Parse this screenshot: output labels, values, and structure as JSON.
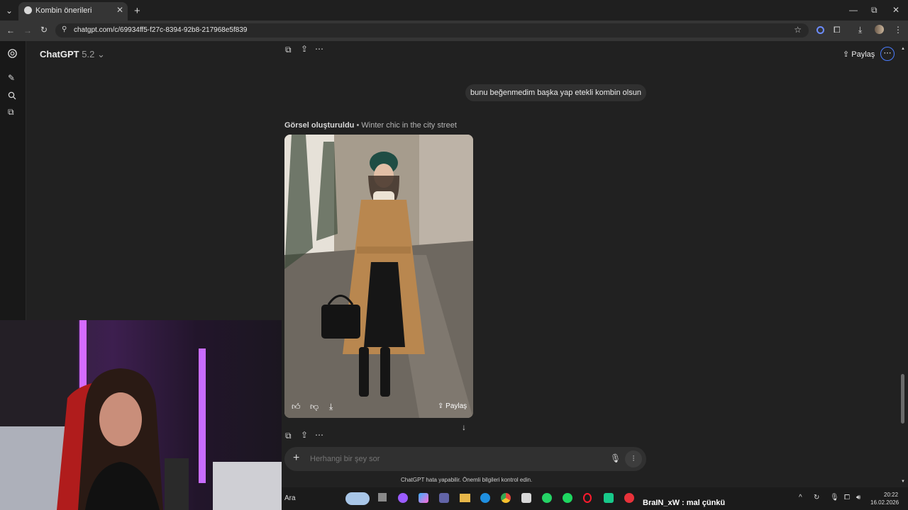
{
  "browser": {
    "tab_title": "Kombin önerileri",
    "url": "chatgpt.com/c/69934ff5-f27c-8394-92b8-217968e5f839"
  },
  "chat": {
    "model_name": "ChatGPT",
    "model_version": "5.2",
    "share_label": "Paylaş",
    "user_message": "bunu beğenmedim başka yap etekli kombin olsun",
    "image_status": "Görsel oluşturuldu",
    "image_caption": "Winter chic in the city street",
    "image_share_label": "Paylaş",
    "composer_placeholder": "Herhangi bir şey sor",
    "disclaimer": "ChatGPT hata yapabilir. Önemli bilgileri kontrol edin."
  },
  "taskbar": {
    "search_label": "Ara",
    "stream_chat": "BraIN_xW : mal çünkü",
    "time": "20:22",
    "date": "16.02.2026"
  },
  "icons": [
    "chatgpt-logo-icon",
    "new-chat-icon",
    "search-icon",
    "library-icon",
    "share-icon",
    "more-icon",
    "copy-icon",
    "upload-icon",
    "thumbs-up-icon",
    "thumbs-down-icon",
    "download-icon",
    "arrow-down-icon",
    "plus-icon",
    "mic-icon",
    "voice-icon"
  ],
  "colors": {
    "accent": "#4a7dff",
    "background": "#212121",
    "composer": "#303030"
  }
}
